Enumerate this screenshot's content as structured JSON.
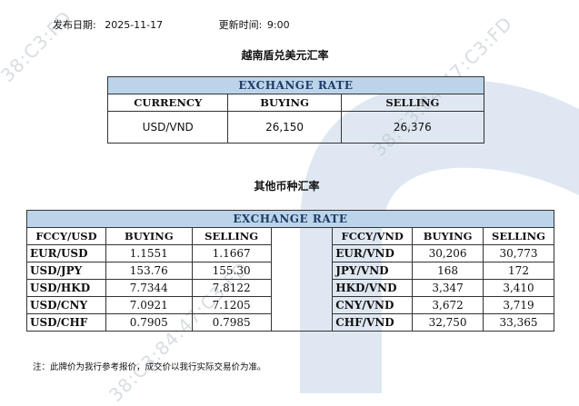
{
  "meta": {
    "date_label": "发布日期:",
    "date_value": "2025-11-17",
    "time_label": "更新时间:",
    "time_value": "9:00"
  },
  "section1": {
    "title": "越南盾兑美元汇率",
    "table_title": "EXCHANGE RATE",
    "headers": [
      "CURRENCY",
      "BUYING",
      "SELLING"
    ],
    "row": {
      "currency": "USD/VND",
      "buying": "26,150",
      "selling": "26,376"
    }
  },
  "section2": {
    "title": "其他币种汇率",
    "table_title": "EXCHANGE  RATE",
    "left_headers": [
      "FCCY/USD",
      "BUYING",
      "SELLING"
    ],
    "right_headers": [
      "FCCY/VND",
      "BUYING",
      "SELLING"
    ],
    "left_rows": [
      {
        "code": "EUR/USD",
        "buying": "1.1551",
        "selling": "1.1667"
      },
      {
        "code": "USD/JPY",
        "buying": "153.76",
        "selling": "155.30"
      },
      {
        "code": "USD/HKD",
        "buying": "7.7344",
        "selling": "7.8122"
      },
      {
        "code": "USD/CNY",
        "buying": "7.0921",
        "selling": "7.1205"
      },
      {
        "code": "USD/CHF",
        "buying": "0.7905",
        "selling": "0.7985"
      }
    ],
    "right_rows": [
      {
        "code": "EUR/VND",
        "buying": "30,206",
        "selling": "30,773"
      },
      {
        "code": "JPY/VND",
        "buying": "168",
        "selling": "172"
      },
      {
        "code": "HKD/VND",
        "buying": "3,347",
        "selling": "3,410"
      },
      {
        "code": "CNY/VND",
        "buying": "3,672",
        "selling": "3,719"
      },
      {
        "code": "CHF/VND",
        "buying": "32,750",
        "selling": "33,365"
      }
    ]
  },
  "note": "注：此牌价为我行参考报价，成交价以我行实际交易价为准。",
  "watermark": [
    "38:C3:FD",
    "38:C3:84:47:C3:FD",
    "38:C3:84:47:C3:FD"
  ],
  "colors": {
    "header_bg": "#bcd4ea",
    "header_text": "#1d3d66",
    "background_shape": "#dbe6f1"
  }
}
